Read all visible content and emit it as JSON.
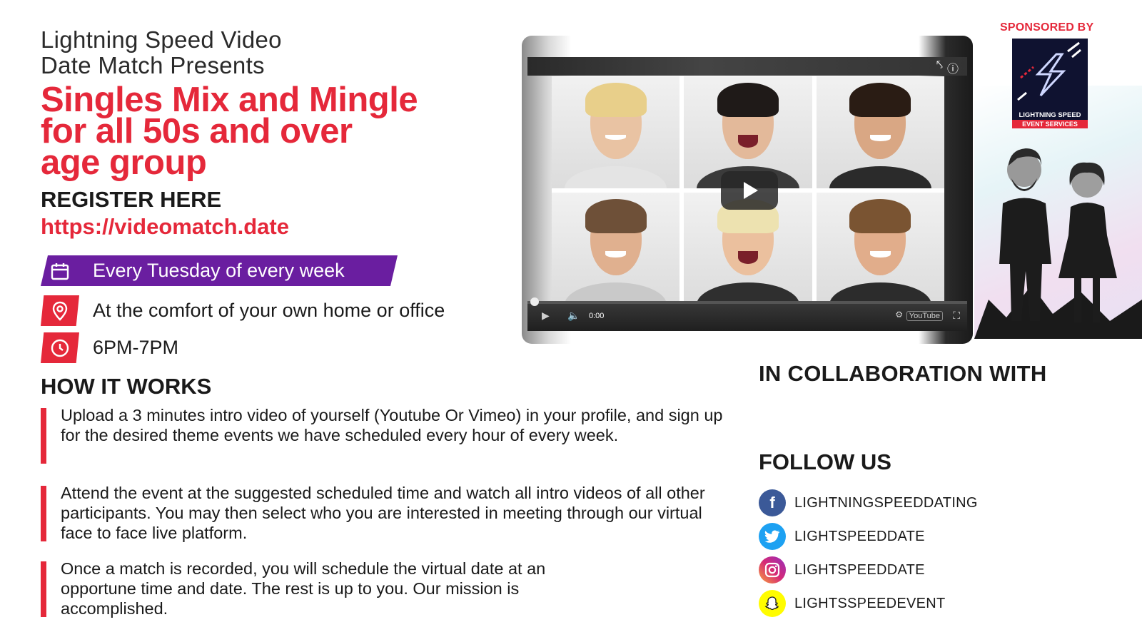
{
  "header": {
    "presenter_line1": "Lightning Speed Video",
    "presenter_line2": "Date Match Presents",
    "headline_line1": "Singles Mix and Mingle",
    "headline_line2": "for all 50s and over",
    "headline_line3": "age group",
    "register_label": "REGISTER HERE",
    "register_url": "https://videomatch.date"
  },
  "event_info": {
    "schedule": "Every Tuesday of every week",
    "location": "At the comfort of your own home or office",
    "time": "6PM-7PM"
  },
  "how_it_works": {
    "title": "HOW IT WORKS",
    "steps": [
      "Upload a 3 minutes intro video of yourself (Youtube Or Vimeo) in your profile, and sign up for the desired theme events we have scheduled every hour of every week.",
      "Attend the event at the suggested scheduled time and watch all intro videos of all other participants. You may then select who you are interested in meeting through our virtual face to face live platform.",
      "Once a match is recorded, you will schedule the virtual date at an opportune time and date. The rest is up to you. Our mission is accomplished."
    ]
  },
  "video_player": {
    "time": "0:00",
    "youtube_label": "YouTube"
  },
  "sponsor": {
    "label": "SPONSORED BY",
    "brand_line1": "LIGHTNING SPEED",
    "brand_line2": "EVENT SERVICES"
  },
  "collaboration": {
    "title": "IN COLLABORATION WITH"
  },
  "follow_us": {
    "title": "FOLLOW US",
    "items": [
      {
        "network": "facebook",
        "icon": "facebook-icon",
        "handle": "LIGHTNINGSPEEDDATING",
        "color": "#3b5998"
      },
      {
        "network": "twitter",
        "icon": "twitter-icon",
        "handle": "LIGHTSPEEDDATE",
        "color": "#1da1f2"
      },
      {
        "network": "instagram",
        "icon": "instagram-icon",
        "handle": "LIGHTSPEEDDATE",
        "color": "#c13584"
      },
      {
        "network": "snapchat",
        "icon": "snapchat-icon",
        "handle": "LIGHTSSPEEDEVENT",
        "color": "#fffc00"
      }
    ]
  },
  "colors": {
    "accent_red": "#e5283a",
    "banner_purple": "#6a1ea0",
    "text_dark": "#1a1a1a"
  }
}
